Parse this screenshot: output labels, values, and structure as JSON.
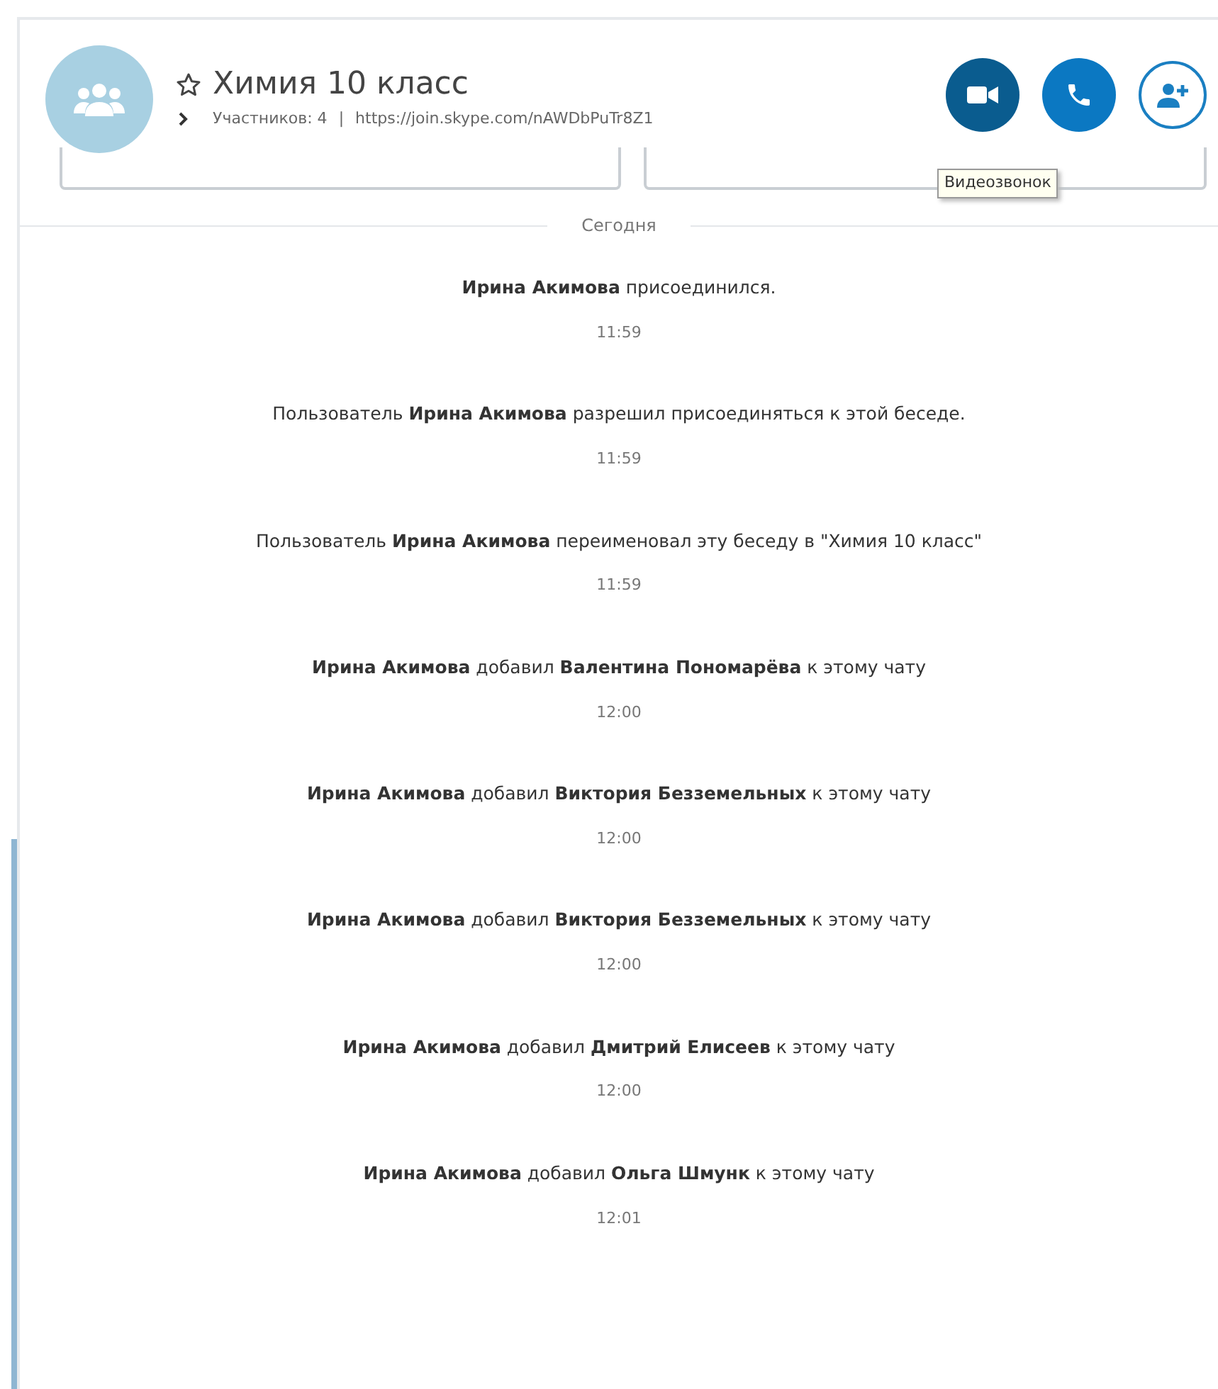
{
  "header": {
    "title": "Химия 10 класс",
    "favorite": false,
    "participants": "Участников: 4",
    "separator": "|",
    "link": "https://join.skype.com/nAWDbPuTr8Z1",
    "tooltip": "Видеозвонок"
  },
  "day_divider": "Сегодня",
  "messages": [
    {
      "text": "**Ирина Акимова** присоединился.",
      "time": "11:59"
    },
    {
      "text": "Пользователь **Ирина Акимова** разрешил присоединяться к этой беседе.",
      "time": "11:59"
    },
    {
      "text": "Пользователь **Ирина Акимова** переименовал эту беседу в \"Химия 10 класс\"",
      "time": "11:59"
    },
    {
      "text": "**Ирина Акимова** добавил **Валентина Пономарёва** к этому чату",
      "time": "12:00"
    },
    {
      "text": "**Ирина Акимова** добавил **Виктория Безземельных** к этому чату",
      "time": "12:00"
    },
    {
      "text": "**Ирина Акимова** добавил **Виктория Безземельных** к этому чату",
      "time": "12:00"
    },
    {
      "text": "**Ирина Акимова** добавил **Дмитрий Елисеев** к этому чату",
      "time": "12:00"
    },
    {
      "text": "**Ирина Акимова** добавил **Ольга Шмунк** к этому чату",
      "time": "12:01"
    }
  ]
}
